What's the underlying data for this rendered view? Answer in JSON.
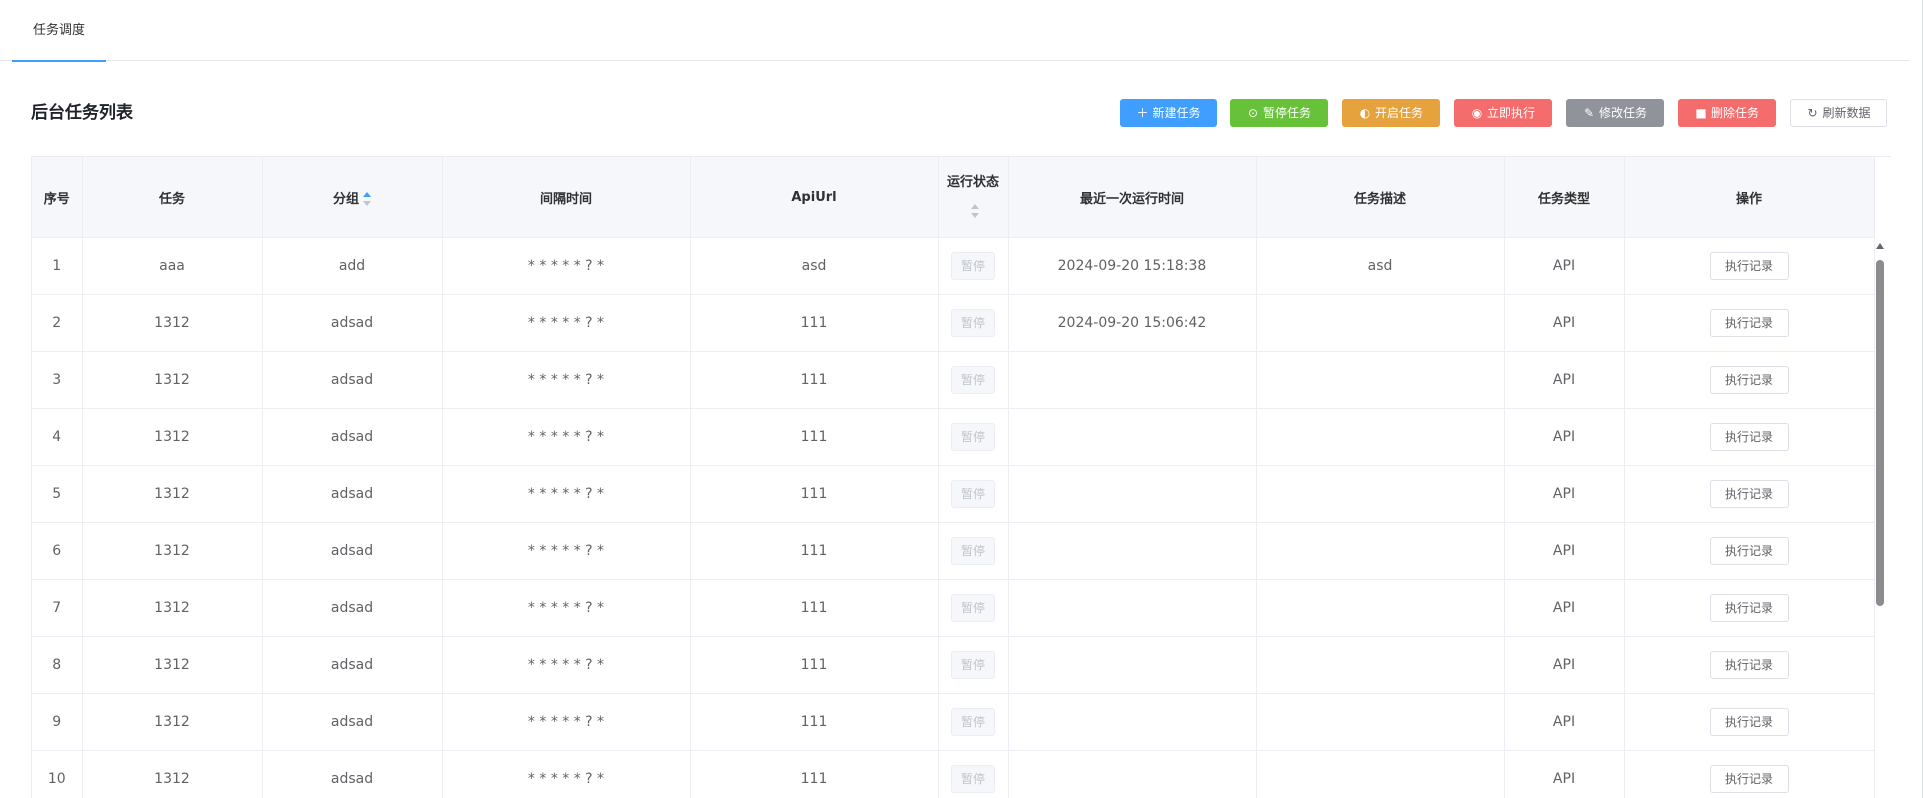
{
  "tabs": [
    {
      "label": "任务调度"
    }
  ],
  "page": {
    "title": "后台任务列表"
  },
  "toolbar": {
    "new_label": "新建任务",
    "pause_label": "暂停任务",
    "start_label": "开启任务",
    "run_label": "立即执行",
    "edit_label": "修改任务",
    "delete_label": "删除任务",
    "refresh_label": "刷新数据",
    "new_icon": "plus-icon",
    "pause_icon": "pause-circle-icon",
    "start_icon": "toggle-icon",
    "run_icon": "play-circle-icon",
    "edit_icon": "pencil-icon",
    "delete_icon": "trash-icon",
    "refresh_icon": "refresh-icon"
  },
  "colors": {
    "primary": "#409eff",
    "success": "#67c23a",
    "warning": "#e6a23c",
    "danger": "#f56c6c",
    "info": "#909399"
  },
  "table": {
    "columns": [
      "序号",
      "任务",
      "分组",
      "间隔时间",
      "ApiUrl",
      "运行状态",
      "最近一次运行时间",
      "任务描述",
      "任务类型",
      "操作"
    ],
    "rows": [
      {
        "no": "1",
        "task": "aaa",
        "group": "add",
        "interval": "* * * * * ? *",
        "api": "asd",
        "status": "暂停",
        "last_run": "2024-09-20 15:18:38",
        "desc": "asd",
        "type": "API",
        "action": "执行记录"
      },
      {
        "no": "2",
        "task": "1312",
        "group": "adsad",
        "interval": "* * * * * ? *",
        "api": "111",
        "status": "暂停",
        "last_run": "2024-09-20 15:06:42",
        "desc": "",
        "type": "API",
        "action": "执行记录"
      },
      {
        "no": "3",
        "task": "1312",
        "group": "adsad",
        "interval": "* * * * * ? *",
        "api": "111",
        "status": "暂停",
        "last_run": "",
        "desc": "",
        "type": "API",
        "action": "执行记录"
      },
      {
        "no": "4",
        "task": "1312",
        "group": "adsad",
        "interval": "* * * * * ? *",
        "api": "111",
        "status": "暂停",
        "last_run": "",
        "desc": "",
        "type": "API",
        "action": "执行记录"
      },
      {
        "no": "5",
        "task": "1312",
        "group": "adsad",
        "interval": "* * * * * ? *",
        "api": "111",
        "status": "暂停",
        "last_run": "",
        "desc": "",
        "type": "API",
        "action": "执行记录"
      },
      {
        "no": "6",
        "task": "1312",
        "group": "adsad",
        "interval": "* * * * * ? *",
        "api": "111",
        "status": "暂停",
        "last_run": "",
        "desc": "",
        "type": "API",
        "action": "执行记录"
      },
      {
        "no": "7",
        "task": "1312",
        "group": "adsad",
        "interval": "* * * * * ? *",
        "api": "111",
        "status": "暂停",
        "last_run": "",
        "desc": "",
        "type": "API",
        "action": "执行记录"
      },
      {
        "no": "8",
        "task": "1312",
        "group": "adsad",
        "interval": "* * * * * ? *",
        "api": "111",
        "status": "暂停",
        "last_run": "",
        "desc": "",
        "type": "API",
        "action": "执行记录"
      },
      {
        "no": "9",
        "task": "1312",
        "group": "adsad",
        "interval": "* * * * * ? *",
        "api": "111",
        "status": "暂停",
        "last_run": "",
        "desc": "",
        "type": "API",
        "action": "执行记录"
      },
      {
        "no": "10",
        "task": "1312",
        "group": "adsad",
        "interval": "* * * * * ? *",
        "api": "111",
        "status": "暂停",
        "last_run": "",
        "desc": "",
        "type": "API",
        "action": "执行记录"
      }
    ]
  }
}
